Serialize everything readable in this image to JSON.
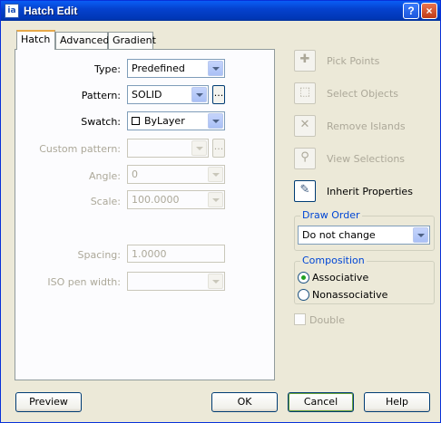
{
  "window": {
    "title": "Hatch Edit",
    "help_glyph": "?",
    "close_glyph": "×",
    "app_icon_text": "ia"
  },
  "tabs": [
    "Hatch",
    "Advanced",
    "Gradient"
  ],
  "hatch": {
    "type_label": "Type:",
    "type_value": "Predefined",
    "pattern_label": "Pattern:",
    "pattern_value": "SOLID",
    "swatch_label": "Swatch:",
    "swatch_value": "ByLayer",
    "custom_pattern_label": "Custom pattern:",
    "custom_pattern_value": "",
    "angle_label": "Angle:",
    "angle_value": "0",
    "scale_label": "Scale:",
    "scale_value": "100.0000",
    "spacing_label": "Spacing:",
    "spacing_value": "1.0000",
    "iso_pen_label": "ISO pen width:",
    "iso_pen_value": "",
    "ellipsis": "..."
  },
  "right_panel": {
    "pick_points": "Pick Points",
    "select_objects": "Select Objects",
    "remove_islands": "Remove Islands",
    "view_selections": "View Selections",
    "inherit_properties": "Inherit Properties",
    "draw_order_label": "Draw Order",
    "draw_order_value": "Do not change",
    "composition_label": "Composition",
    "associative": "Associative",
    "nonassociative": "Nonassociative",
    "double": "Double"
  },
  "buttons": {
    "preview": "Preview",
    "ok": "OK",
    "cancel": "Cancel",
    "help": "Help"
  },
  "colors": {
    "title_bar": "#0542cf",
    "dialog_bg": "#ece9d8",
    "group_label": "#0046d5",
    "disabled_text": "#aca899"
  }
}
